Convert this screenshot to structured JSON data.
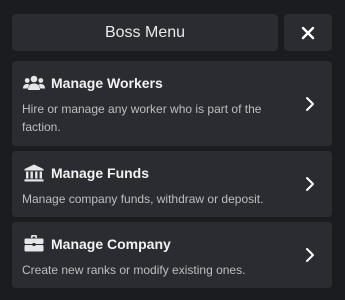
{
  "header": {
    "title": "Boss Menu",
    "close_icon": "close-icon"
  },
  "menu": {
    "items": [
      {
        "icon": "users-icon",
        "title": "Manage Workers",
        "description": "Hire or manage any worker who is part of the faction."
      },
      {
        "icon": "bank-icon",
        "title": "Manage Funds",
        "description": "Manage company funds, withdraw or deposit."
      },
      {
        "icon": "briefcase-icon",
        "title": "Manage Company",
        "description": "Create new ranks or modify existing ones."
      }
    ]
  },
  "colors": {
    "background": "#1b1c1f",
    "panel": "#2b2c31",
    "text": "#f2f2f2",
    "muted_text": "#bdbdc2"
  }
}
